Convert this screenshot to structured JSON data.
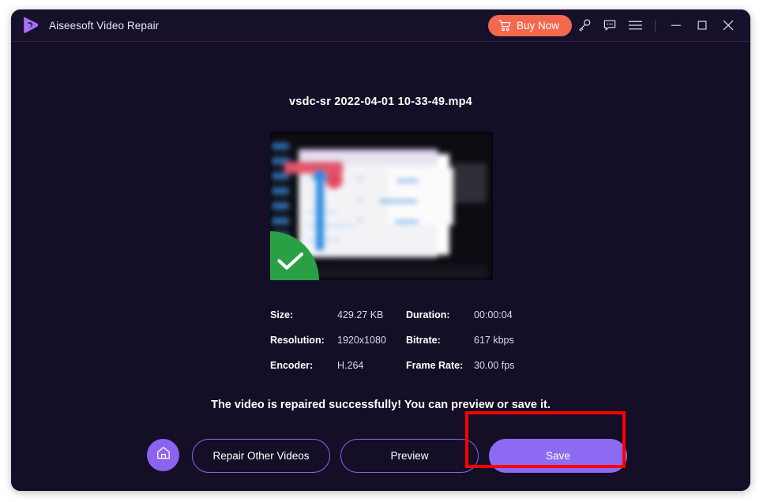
{
  "window": {
    "app_title": "Aiseesoft Video Repair",
    "logo_icon": "aiseesoft-play-logo"
  },
  "titlebar": {
    "buy_now_label": "Buy Now",
    "cart_icon": "shopping-cart-icon",
    "key_icon": "key-icon",
    "feedback_icon": "chat-bubble-icon",
    "menu_icon": "hamburger-menu-icon",
    "minimize_icon": "minimize-icon",
    "maximize_icon": "maximize-icon",
    "close_icon": "close-icon"
  },
  "main": {
    "file_name": "vsdc-sr 2022-04-01 10-33-49.mp4",
    "thumbnail_badge_icon": "green-check-icon",
    "success_message": "The video is repaired successfully! You can preview or save it.",
    "info": {
      "rows": [
        {
          "label_left": "Size:",
          "value_left": "429.27 KB",
          "label_right": "Duration:",
          "value_right": "00:00:04"
        },
        {
          "label_left": "Resolution:",
          "value_left": "1920x1080",
          "label_right": "Bitrate:",
          "value_right": "617 kbps"
        },
        {
          "label_left": "Encoder:",
          "value_left": "H.264",
          "label_right": "Frame Rate:",
          "value_right": "30.00 fps"
        }
      ]
    }
  },
  "actions": {
    "home_icon": "home-icon",
    "repair_other_label": "Repair Other Videos",
    "preview_label": "Preview",
    "save_label": "Save"
  },
  "annotation": {
    "highlight_target": "save-button",
    "highlight_color": "#fe0000"
  },
  "colors": {
    "window_background": "#140e26",
    "titlebar_background": "#17102b",
    "accent_purple": "#8c63f0",
    "buy_now_orange": "#f4684f",
    "success_green": "#2aa045",
    "text_primary": "#ffffff"
  }
}
